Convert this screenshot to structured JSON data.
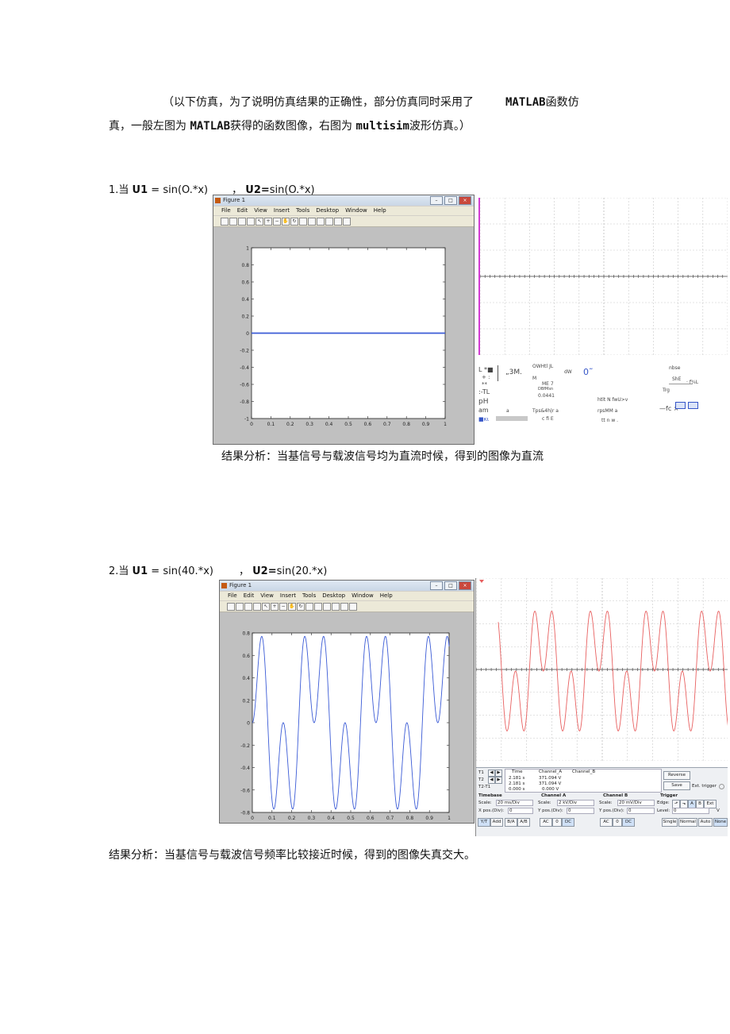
{
  "intro": {
    "line1_a": "（以下仿真，为了说明仿真结果的正确性，部分仿真同时采用了",
    "line1_b": "MATLAB",
    "line1_c": "函数仿",
    "line2_a": "真，一般左图为",
    "line2_b": "MATLAB",
    "line2_c": "获得的函数图像，右图为",
    "line2_d": "multisim",
    "line2_e": "波形仿真。）"
  },
  "section1": {
    "heading_a": "1.当",
    "heading_u1": "U1",
    "heading_b": "= sin(O.*x)",
    "heading_c": "，",
    "heading_u2": "U2=",
    "heading_d": "sin(O.*x)",
    "analysis": "结果分析：当基信号与载波信号均为直流时候，得到的图像为直流",
    "figure": {
      "title": "Figure 1",
      "menus": [
        "File",
        "Edit",
        "View",
        "Insert",
        "Tools",
        "Desktop",
        "Window",
        "Help"
      ],
      "y_ticks": [
        "1",
        "0.8",
        "0.6",
        "0.4",
        "0.2",
        "0",
        "-0.2",
        "-0.4",
        "-0.6",
        "-0.8",
        "-1"
      ],
      "x_ticks": [
        "0",
        "0.1",
        "0.2",
        "0.3",
        "0.4",
        "0.5",
        "0.6",
        "0.7",
        "0.8",
        "0.9",
        "1"
      ]
    },
    "chart_data": {
      "type": "line",
      "x": [
        0,
        0.1,
        0.2,
        0.3,
        0.4,
        0.5,
        0.6,
        0.7,
        0.8,
        0.9,
        1
      ],
      "series": [
        {
          "values": [
            0,
            0,
            0,
            0,
            0,
            0,
            0,
            0,
            0,
            0,
            0
          ]
        }
      ],
      "xlim": [
        0,
        1
      ],
      "ylim": [
        -1,
        1
      ],
      "line_color": "#3b5bd6"
    },
    "scope_ocr": {
      "t1": "L *■",
      "t2": "+ :",
      "t3": "**",
      "t4": ":-TL",
      "t5": "pH",
      "t6": "am",
      "t7": "■κι",
      "t8": "„3M.",
      "t9": "OWHtl JL",
      "t10": "M",
      "t11": "ME 7",
      "t12": "DBfMsn",
      "t13": "0.0441",
      "t14": "dW",
      "t15": "0˜",
      "t16": "nbse",
      "t17": "ShE",
      "t18": "· f¾L",
      "t19": "Trg",
      "t20": "a",
      "t21": "Tps&4h|r a",
      "t22": "c    fi    E",
      "t23": "htlt N fwU>v",
      "t24": "rpsMM a",
      "t25": "tt    n    w    .",
      "t26": "—fc ×"
    }
  },
  "section2": {
    "heading_a": "2.当",
    "heading_u1": "U1",
    "heading_b": "= sin(40.*x)",
    "heading_c": "，",
    "heading_u2": "U2=",
    "heading_d": "sin(20.*x)",
    "analysis": "结果分析：当基信号与载波信号频率比较接近时候，得到的图像失真交大。",
    "figure": {
      "title": "Figure 1",
      "menus": [
        "File",
        "Edit",
        "View",
        "Insert",
        "Tools",
        "Desktop",
        "Window",
        "Help"
      ],
      "y_ticks": [
        "0.8",
        "0.6",
        "0.4",
        "0.2",
        "0",
        "-0.2",
        "-0.4",
        "-0.6",
        "-0.8"
      ],
      "x_ticks": [
        "0",
        "0.1",
        "0.2",
        "0.3",
        "0.4",
        "0.5",
        "0.6",
        "0.7",
        "0.8",
        "0.9",
        "1"
      ]
    },
    "chart_data": {
      "type": "line",
      "function": "sin(40*x)*sin(20*x)",
      "x_range": [
        0,
        1
      ],
      "xlim": [
        0,
        1
      ],
      "ylim": [
        -0.8,
        0.8
      ],
      "line_color": "#3b5bd6"
    },
    "scope_panel": {
      "t1": "T1",
      "t2": "T2",
      "t21": "T2-T1",
      "col_time": "Time",
      "col_cha": "Channel_A",
      "col_chb": "Channel_B",
      "r1_time": "2.181 s",
      "r1_a": "371.094 V",
      "r2_time": "2.181 s",
      "r2_a": "371.094 V",
      "r3_time": "0.000 s",
      "r3_a": "0.000 V",
      "reverse": "Reverse",
      "save": "Save",
      "ext_trigger": "Ext. trigger",
      "timebase": "Timebase",
      "scale_tb": "Scale:",
      "scale_tb_val": "20 ms/Div",
      "xpos": "X pos.(Div):",
      "xpos_val": "0",
      "cha": "Channel A",
      "scale_a": "Scale:",
      "scale_a_val": "2 kV/Div",
      "ypos_a": "Y pos.(Div):",
      "ypos_a_val": "0",
      "chb": "Channel B",
      "scale_b": "Scale:",
      "scale_b_val": "20 mV/Div",
      "ypos_b": "Y pos.(Div):",
      "ypos_b_val": "0",
      "trigger": "Trigger",
      "edge": "Edge:",
      "level": "Level:",
      "level_val": "0",
      "level_unit": "V",
      "b_yt": "Y/T",
      "b_add": "Add",
      "b_ba": "B/A",
      "b_ab": "A/B",
      "b_ac": "AC",
      "b_0": "0",
      "b_dc": "DC",
      "b_single": "Single",
      "b_normal": "Normal",
      "b_auto": "Auto",
      "b_none": "None",
      "e_a": "A",
      "e_b": "B",
      "e_ext": "Ext"
    },
    "scope_chart": {
      "type": "line",
      "function": "sin(40*x)*sin(20*x)",
      "line_color": "#e86060"
    }
  }
}
